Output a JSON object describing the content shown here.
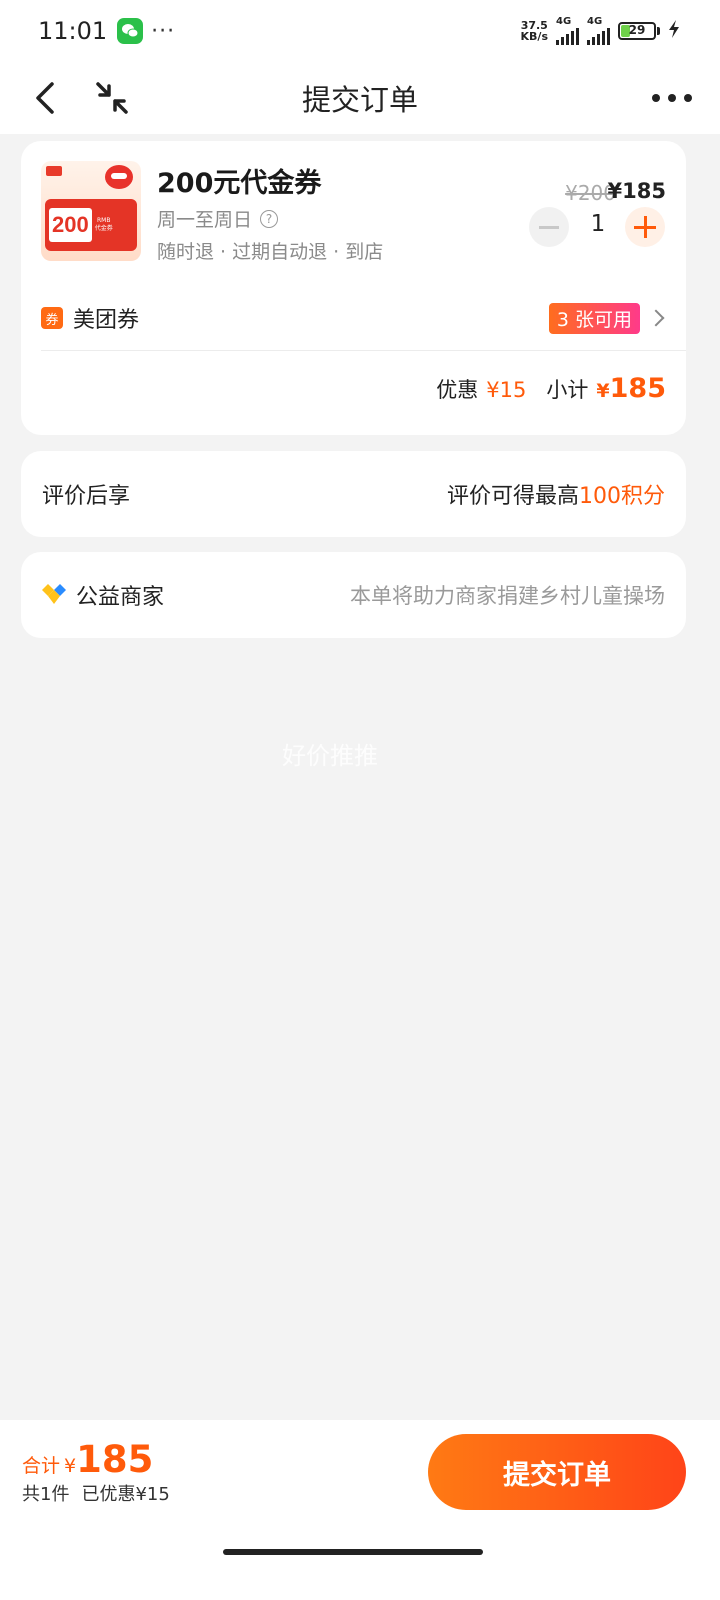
{
  "status_bar": {
    "time": "11:01",
    "wechat_icon": "wechat-icon",
    "more_dots": "···",
    "net_speed_value": "37.5",
    "net_speed_unit": "KB/s",
    "signal_1_label": "4G",
    "signal_2_label": "4G",
    "battery_level": "29",
    "battery_fraction": 0.29,
    "charging_icon": "bolt-icon"
  },
  "nav": {
    "title": "提交订单",
    "back_icon": "back-arrow-icon",
    "shrink_icon": "minimize-icon",
    "more_icon": "more-dots-icon"
  },
  "product": {
    "thumbnail_amount": "200",
    "thumbnail_sub_1": "RMB",
    "thumbnail_sub_2": "代金券",
    "title": "200元代金券",
    "days": "周一至周日",
    "rules": "随时退 · 过期自动退 · 到店",
    "original_price": "¥200",
    "price": "¥185",
    "quantity": "1"
  },
  "coupon": {
    "icon_text": "券",
    "label": "美团券",
    "badge": "3 张可用"
  },
  "subtotal": {
    "discount_label": "优惠",
    "discount_value": "¥15",
    "subtotal_label": "小计",
    "subtotal_yen": "¥",
    "subtotal_value": "185"
  },
  "review": {
    "label": "评价后享",
    "text": "评价可得最高",
    "points": "100积分"
  },
  "charity": {
    "label": "公益商家",
    "text": "本单将助力商家捐建乡村儿童操场"
  },
  "watermark": "好价推推",
  "bottom": {
    "total_label": "合计",
    "total_yen": "¥",
    "total_value": "185",
    "count_text": "共1件",
    "saved_text": "已优惠¥15",
    "submit_label": "提交订单"
  },
  "colors": {
    "accent": "#ff5a0a",
    "background": "#f3f3f3",
    "card": "#ffffff"
  }
}
